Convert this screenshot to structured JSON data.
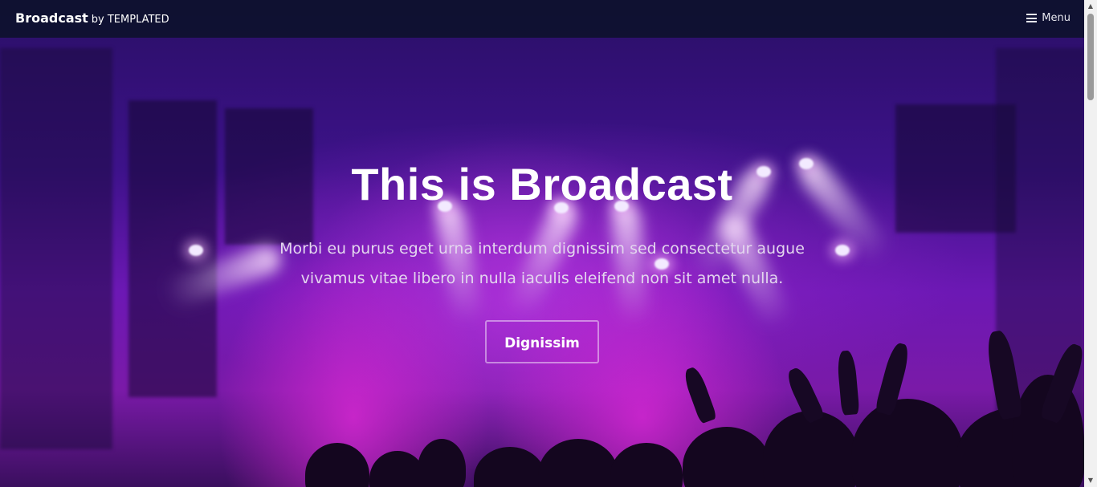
{
  "header": {
    "brand_name": "Broadcast",
    "brand_by": "by TEMPLATED",
    "menu_label": "Menu",
    "menu_icon": "hamburger-icon"
  },
  "banner": {
    "title": "This is Broadcast",
    "subtitle": "Morbi eu purus eget urna interdum dignissim sed consectetur augue vivamus vitae libero in nulla iaculis eleifend non sit amet nulla.",
    "button_label": "Dignissim"
  },
  "colors": {
    "header_bg": "#0a1228",
    "accent_purple": "#7a1aa8",
    "text": "#ffffff"
  }
}
